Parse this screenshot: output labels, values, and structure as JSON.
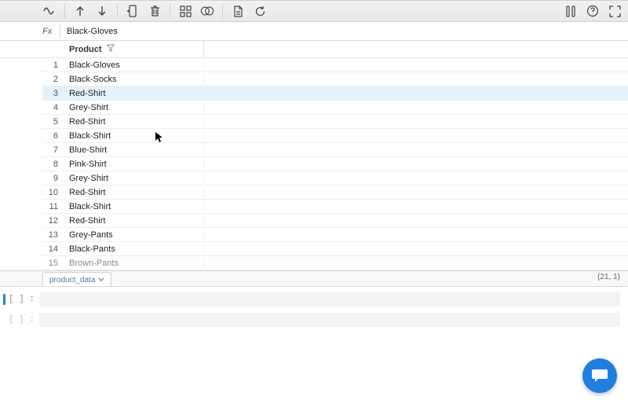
{
  "fx": {
    "label": "Fx",
    "value": "Black-Gloves"
  },
  "column_header": "Product",
  "selected_row": 3,
  "visible_rows": [
    {
      "n": 1,
      "v": "Black-Gloves"
    },
    {
      "n": 2,
      "v": "Black-Socks"
    },
    {
      "n": 3,
      "v": "Red-Shirt"
    },
    {
      "n": 4,
      "v": "Grey-Shirt"
    },
    {
      "n": 5,
      "v": "Red-Shirt"
    },
    {
      "n": 6,
      "v": "Black-Shirt"
    },
    {
      "n": 7,
      "v": "Blue-Shirt"
    },
    {
      "n": 8,
      "v": "Pink-Shirt"
    },
    {
      "n": 9,
      "v": "Grey-Shirt"
    },
    {
      "n": 10,
      "v": "Red-Shirt"
    },
    {
      "n": 11,
      "v": "Black-Shirt"
    },
    {
      "n": 12,
      "v": "Red-Shirt"
    },
    {
      "n": 13,
      "v": "Grey-Pants"
    },
    {
      "n": 14,
      "v": "Black-Pants"
    },
    {
      "n": 15,
      "v": "Brown-Pants"
    }
  ],
  "sheet_tab": "product_data",
  "dims": "(21, 1)",
  "code_prompt": "[  ] :"
}
